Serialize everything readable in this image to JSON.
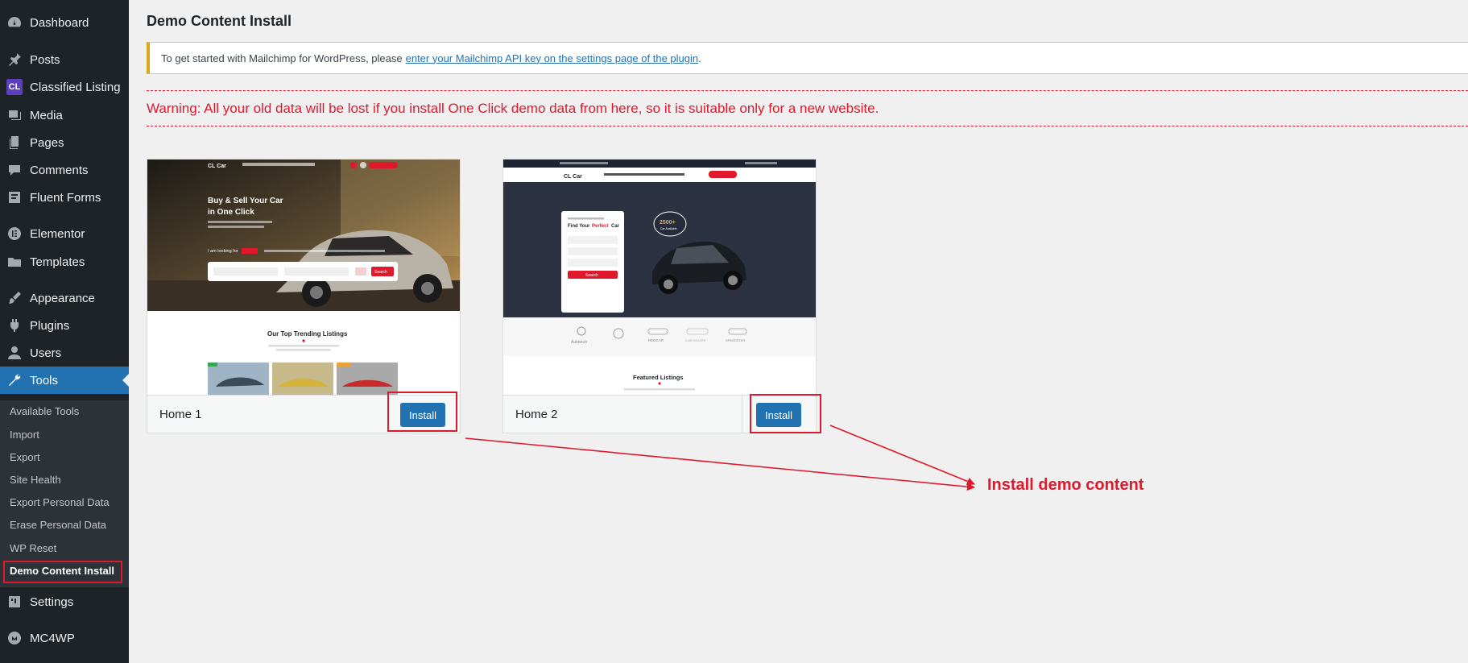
{
  "sidebar": {
    "items": [
      {
        "label": "Dashboard",
        "icon": "dashboard-icon"
      },
      {
        "label": "Posts",
        "icon": "pin-icon"
      },
      {
        "label": "Classified Listing",
        "icon": "cl-logo-icon",
        "badge": "CL"
      },
      {
        "label": "Media",
        "icon": "media-icon"
      },
      {
        "label": "Pages",
        "icon": "pages-icon"
      },
      {
        "label": "Comments",
        "icon": "comment-icon"
      },
      {
        "label": "Fluent Forms",
        "icon": "forms-icon"
      },
      {
        "label": "Elementor",
        "icon": "elementor-icon"
      },
      {
        "label": "Templates",
        "icon": "folder-icon"
      },
      {
        "label": "Appearance",
        "icon": "brush-icon"
      },
      {
        "label": "Plugins",
        "icon": "plugin-icon"
      },
      {
        "label": "Users",
        "icon": "user-icon"
      },
      {
        "label": "Tools",
        "icon": "wrench-icon"
      },
      {
        "label": "Settings",
        "icon": "settings-icon"
      },
      {
        "label": "MC4WP",
        "icon": "mc4wp-icon"
      }
    ],
    "tools_submenu": [
      "Available Tools",
      "Import",
      "Export",
      "Site Health",
      "Export Personal Data",
      "Erase Personal Data",
      "WP Reset",
      "Demo Content Install"
    ]
  },
  "page": {
    "title": "Demo Content Install",
    "notice_text": "To get started with Mailchimp for WordPress, please",
    "notice_link": "enter your Mailchimp API key on the settings page of the plugin",
    "notice_end": ".",
    "warning": "Warning: All your old data will be lost if you install One Click demo data from here, so it is suitable only for a new website."
  },
  "demos": [
    {
      "name": "Home 1",
      "button": "Install",
      "preview": {
        "logo": "CL Car",
        "headline_1": "Buy & Sell Your Car",
        "headline_2": "in One Click",
        "looking_for": "I am looking for",
        "search": "Search",
        "section": "Our Top Trending Listings"
      }
    },
    {
      "name": "Home 2",
      "button": "Install",
      "preview": {
        "logo": "CL Car",
        "find_1": "Find Your",
        "find_2": "Perfect",
        "find_3": "Car",
        "badge_num": "2500+",
        "badge_txt": "Car Available",
        "search": "Search",
        "brands": [
          "Autotech",
          "",
          "REDCAR",
          "CAR DEALER",
          "SPEEDSTER"
        ],
        "section": "Featured Listings"
      }
    }
  ],
  "annotation": {
    "callout": "Install demo content",
    "color": "#e0182c"
  },
  "colors": {
    "sidebar_bg": "#1d2327",
    "active": "#2271b1",
    "accent_red": "#e0182c",
    "notice_border": "#dba617"
  }
}
